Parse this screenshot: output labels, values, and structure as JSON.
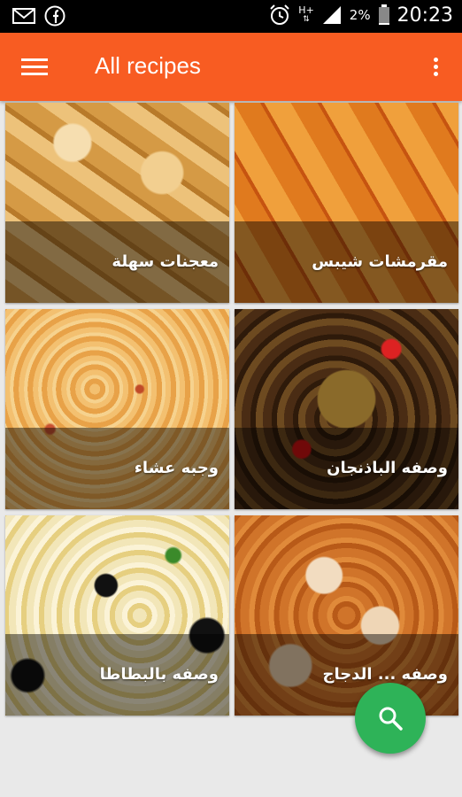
{
  "status_bar": {
    "time": "20:23",
    "battery": "2%",
    "network_type": "H+",
    "icons": [
      "mail-icon",
      "facebook-icon",
      "alarm-icon",
      "signal-icon",
      "battery-icon"
    ]
  },
  "app_bar": {
    "title": "All recipes",
    "color": "#f85c22",
    "icons": [
      "menu-icon",
      "overflow-menu-icon"
    ]
  },
  "recipes": [
    {
      "title": "معجنات سهلة"
    },
    {
      "title": "مقرمشات شيبس"
    },
    {
      "title": "وجبه عشاء"
    },
    {
      "title": "وصفه الباذنجان"
    },
    {
      "title": "وصفه بالبطاطا"
    },
    {
      "title": "وصفه ... الدجاج"
    }
  ],
  "fab": {
    "icon": "search-icon",
    "color": "#2eb358"
  }
}
